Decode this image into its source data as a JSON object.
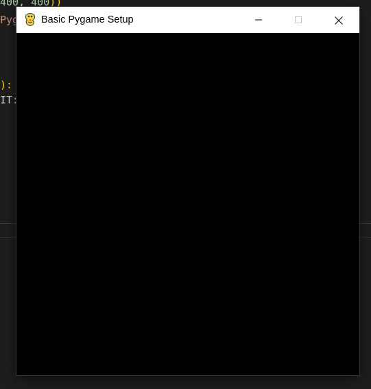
{
  "editor": {
    "line1": {
      "text_a": "400",
      "text_b": ", ",
      "text_c": "400",
      "text_d": "))"
    },
    "line2": {
      "text": "Pyg"
    },
    "line3": {
      "text": "):"
    },
    "line4": {
      "text": "IT:"
    }
  },
  "window": {
    "title": "Basic Pygame Setup",
    "icon": "pygame-snake-icon",
    "minimize_icon": "minimize-icon",
    "maximize_icon": "maximize-icon",
    "close_icon": "close-icon",
    "maximize_disabled": true
  },
  "colors": {
    "canvas_background": "#000000",
    "titlebar_background": "#ffffff",
    "editor_background": "#1e1e1e"
  }
}
